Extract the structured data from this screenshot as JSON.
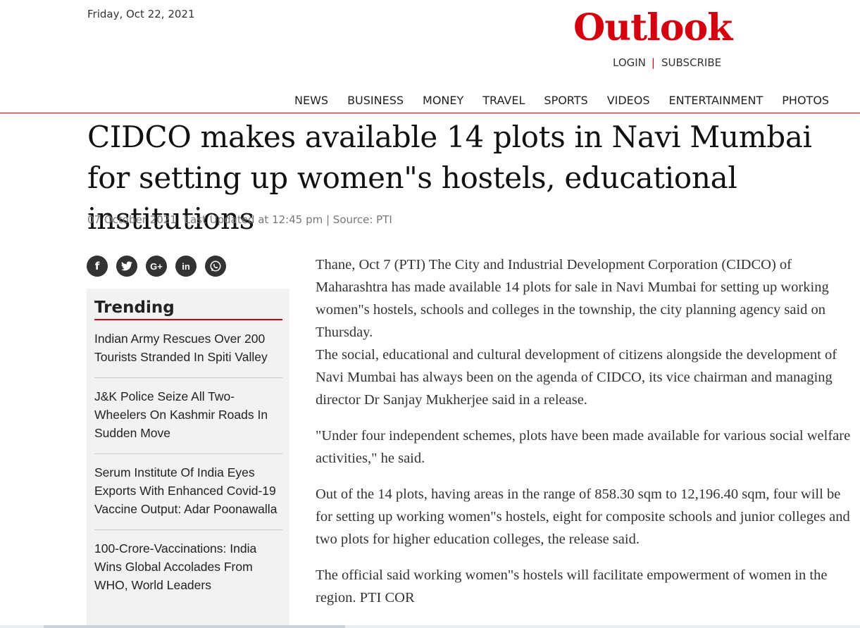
{
  "header": {
    "date": "Friday, Oct 22, 2021",
    "logo": "Outlook",
    "login": "LOGIN",
    "separator": "|",
    "subscribe": "SUBSCRIBE"
  },
  "nav": [
    "NEWS",
    "BUSINESS",
    "MONEY",
    "TRAVEL",
    "SPORTS",
    "VIDEOS",
    "ENTERTAINMENT",
    "PHOTOS"
  ],
  "article": {
    "title": "CIDCO makes available 14 plots in Navi Mumbai for setting up women\"s hostels, educational institutions",
    "published": "07 October 2021",
    "updated": "Last Updated at 12:45 pm | Source: PTI",
    "paragraphs": [
      "Thane, Oct 7 (PTI) The City and Industrial Development Corporation (CIDCO) of Maharashtra has made available 14 plots for sale in Navi Mumbai for setting up working women\"s hostels, schools and colleges in the township, the city planning agency said on Thursday.",
      "The social, educational and cultural development of citizens alongside the development of Navi Mumbai has always been on the agenda of CIDCO, its vice chairman and managing director Dr Sanjay Mukherjee said in a release.",
      "\"Under four independent schemes, plots have been made available for various social welfare activities,\" he said.",
      "Out of the 14 plots, having areas in the range of 858.30 sqm to 12,196.40 sqm, four will be for setting up working women\"s hostels, eight for composite schools and junior colleges and two plots for higher education colleges, the release said.",
      "The official said working women\"s hostels will facilitate empowerment of women in the region. PTI COR"
    ]
  },
  "share": {
    "facebook": "f",
    "twitter": "twitter-bird",
    "google": "G+",
    "linkedin": "in",
    "whatsapp": "whatsapp-phone"
  },
  "trending": {
    "title": "Trending",
    "items": [
      "Indian Army Rescues Over 200 Tourists Stranded In Spiti Valley",
      "J&K Police Seize All Two-Wheelers On Kashmir Roads In Sudden Move",
      "Serum Institute Of India Eyes Exports With Enhanced Covid-19 Vaccine Output: Adar Poonawalla",
      "100-Crore-Vaccinations: India Wins Global Accolades From WHO, World Leaders"
    ]
  },
  "colors": {
    "brand": "#d4000f",
    "icon_bg": "#333333",
    "sidebar_bg": "#f2f2f2"
  }
}
